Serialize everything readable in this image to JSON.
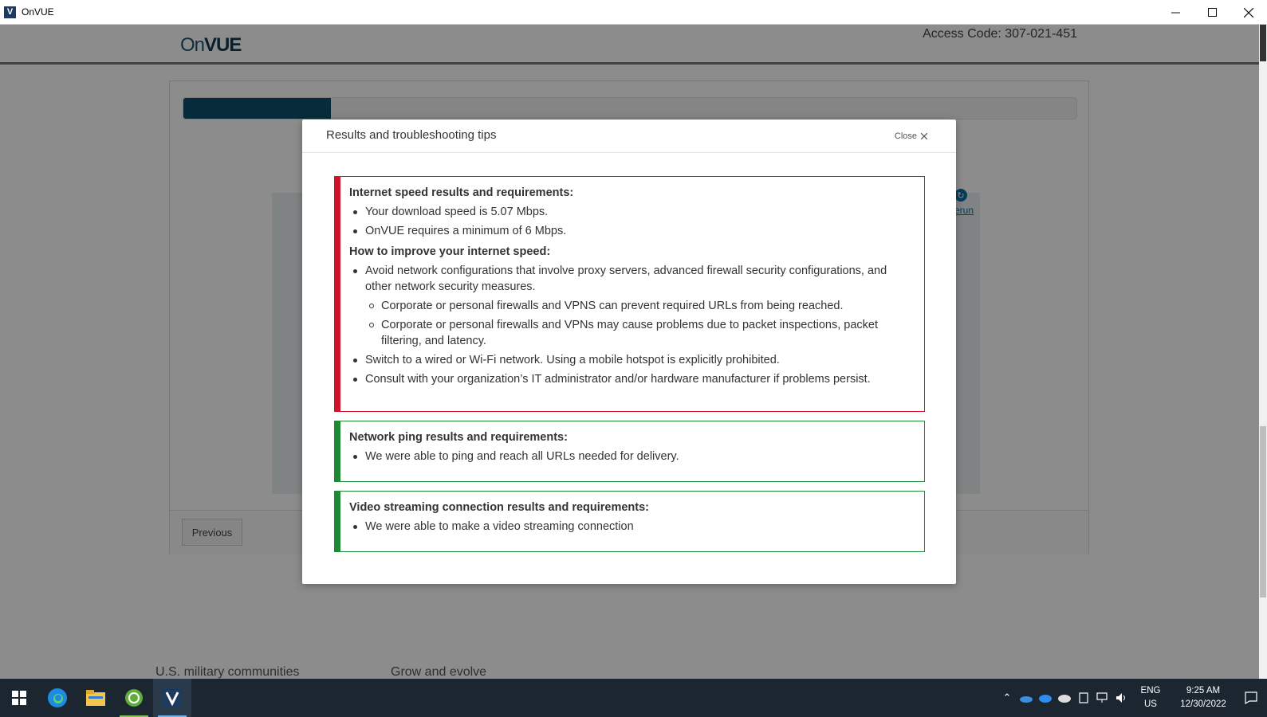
{
  "window": {
    "title": "OnVUE",
    "icon_letter": "V"
  },
  "app": {
    "logo_text_on": "On",
    "logo_text_vue": "VUE",
    "access_code": "Access Code: 307-021-451",
    "progress_fraction": 0.165,
    "rerun_label": "rerun",
    "previous_label": "Previous",
    "footer_left": "U.S. military communities",
    "footer_right": "Grow and evolve"
  },
  "modal": {
    "title": "Results and troubleshooting tips",
    "close_label": "Close",
    "internet": {
      "heading": "Internet speed results and requirements:",
      "items": [
        "Your download speed is 5.07 Mbps.",
        "OnVUE requires a minimum of 6 Mbps."
      ],
      "improve_heading": "How to improve your internet speed:",
      "improve_items": [
        "Avoid network configurations that involve proxy servers, advanced firewall security configurations, and other network security measures.",
        "Corporate or personal firewalls and VPNS can prevent required URLs from being reached.",
        "Corporate or personal firewalls and VPNs may cause problems due to packet inspections, packet filtering, and latency.",
        "Switch to a wired or Wi-Fi network. Using a mobile hotspot is explicitly prohibited.",
        "Consult with your organization’s IT administrator and/or hardware manufacturer if problems persist."
      ],
      "status_color": "#d0142c"
    },
    "ping": {
      "heading": "Network ping results and requirements:",
      "items": [
        "We were able to ping and reach all URLs needed for delivery."
      ],
      "status_color": "#1f8a36"
    },
    "video": {
      "heading": "Video streaming connection results and requirements:",
      "items": [
        "We were able to make a video streaming connection"
      ],
      "status_color": "#1f8a36"
    }
  },
  "taskbar": {
    "language": "ENG",
    "region": "US",
    "time": "9:25 AM",
    "date": "12/30/2022",
    "apps": [
      "start-icon",
      "edge-icon",
      "file-explorer-icon",
      "green-app-icon",
      "onvue-icon"
    ]
  }
}
